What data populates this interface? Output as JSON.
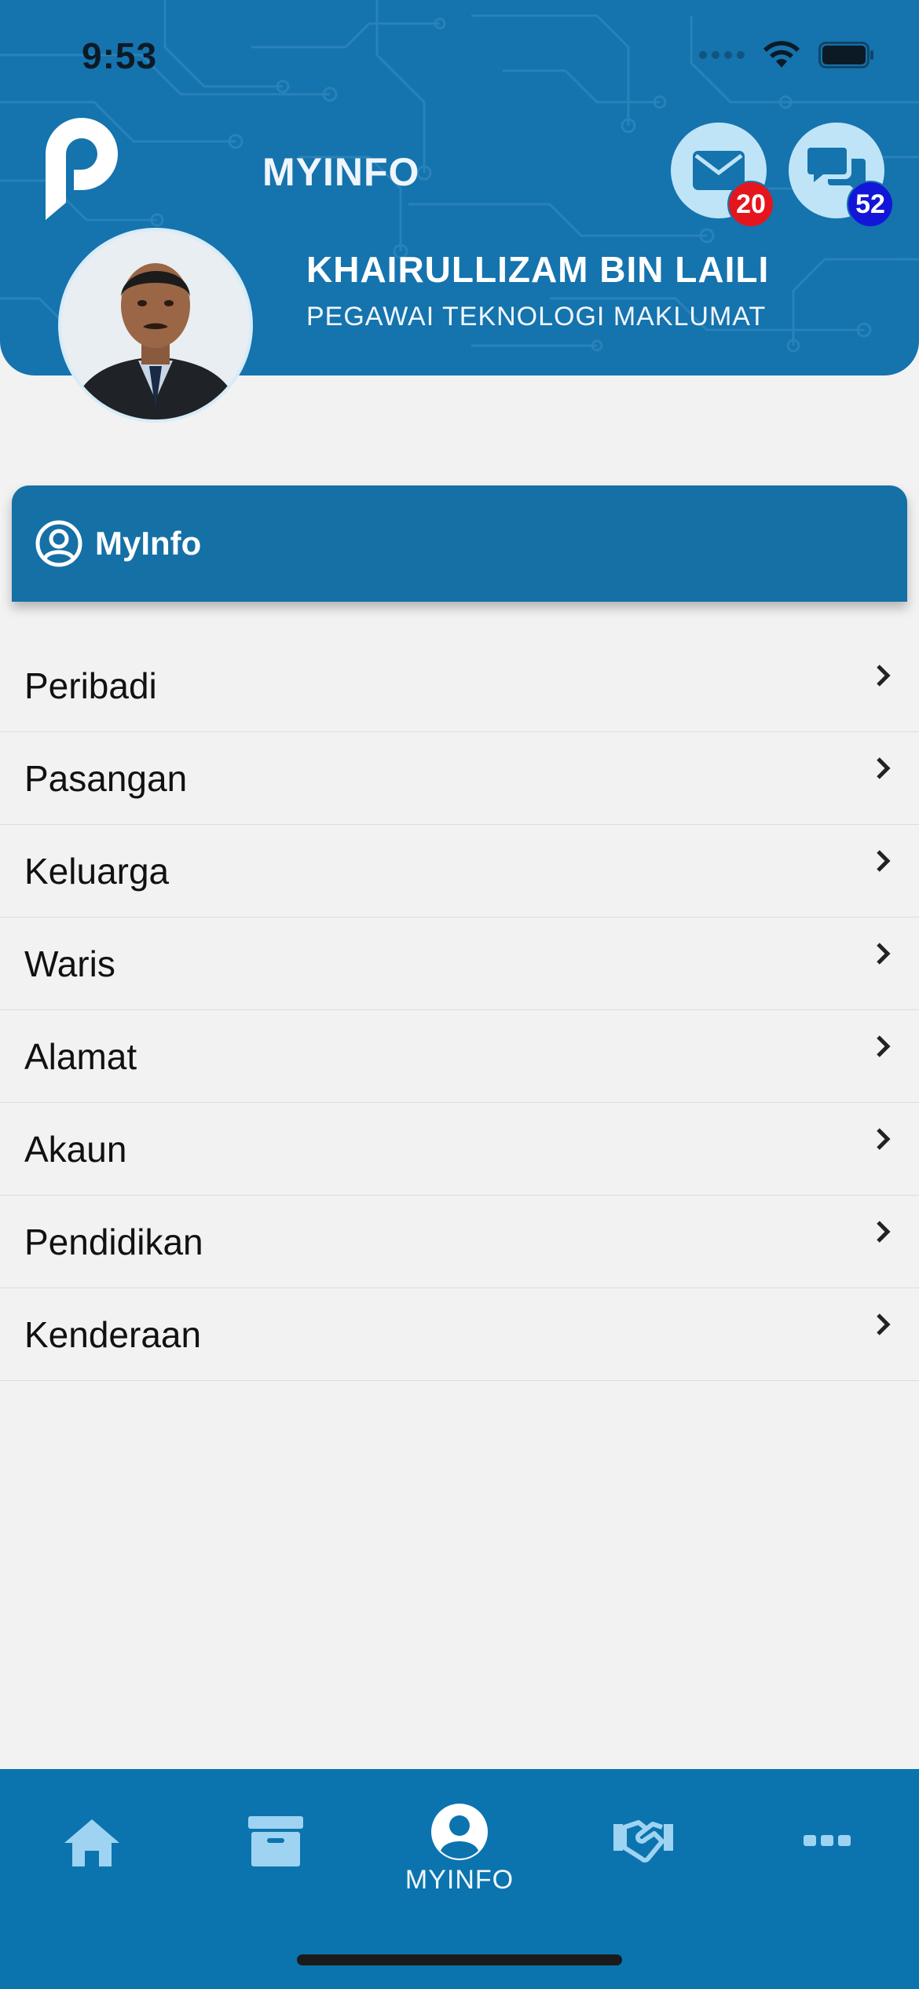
{
  "status_bar": {
    "time": "9:53"
  },
  "header": {
    "app_title": "MYINFO",
    "user_name": "KHAIRULLIZAM BIN LAILI",
    "user_position": "PEGAWAI TEKNOLOGI MAKLUMAT",
    "mail_badge": "20",
    "chat_badge": "52",
    "colors": {
      "background": "#1573ad",
      "mail_badge": "#e5151d",
      "chat_badge": "#1316d8",
      "icon_button": "#bfe4f7"
    }
  },
  "section": {
    "title": "MyInfo",
    "icon": "user-circle-icon"
  },
  "menu": {
    "items": [
      {
        "label": "Peribadi"
      },
      {
        "label": "Pasangan"
      },
      {
        "label": "Keluarga"
      },
      {
        "label": "Waris"
      },
      {
        "label": "Alamat"
      },
      {
        "label": "Akaun"
      },
      {
        "label": "Pendidikan"
      },
      {
        "label": "Kenderaan"
      }
    ]
  },
  "tabbar": {
    "tabs": [
      {
        "icon": "home-icon"
      },
      {
        "icon": "archive-icon"
      },
      {
        "icon": "user-circle-icon",
        "label": "MYINFO",
        "active": true
      },
      {
        "icon": "handshake-icon"
      },
      {
        "icon": "more-icon"
      }
    ]
  }
}
